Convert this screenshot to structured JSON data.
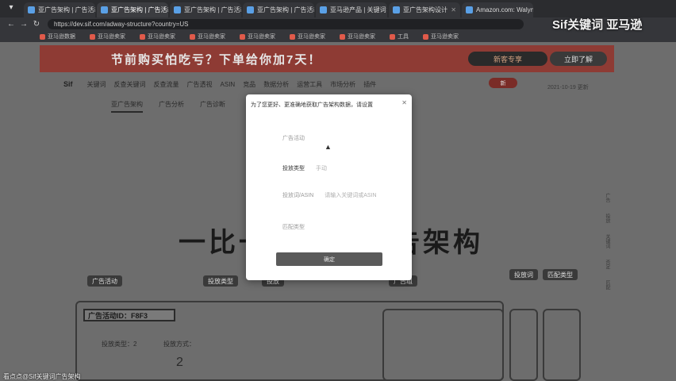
{
  "browser": {
    "tabs": [
      {
        "label": "亚广告架构 | 广告活动"
      },
      {
        "label": "亚广告架构 | 广告活动"
      },
      {
        "label": "亚广告架构 | 广告活动"
      },
      {
        "label": "亚广告架构 | 广告活动"
      },
      {
        "label": "亚马逊产品 | 关键词"
      },
      {
        "label": "亚广告架构设计"
      },
      {
        "label": "Amazon.com: Walyn"
      }
    ],
    "url": "https://dev.sif.com/adway-structure?country=US",
    "bookmarks": [
      "亚马逊数据",
      "亚马逊卖家",
      "亚马逊卖家",
      "亚马逊卖家",
      "亚马逊卖家",
      "亚马逊卖家",
      "亚马逊卖家",
      "工具",
      "亚马逊卖家"
    ]
  },
  "page": {
    "banner_text": "节前购买怕吃亏？下单给你加7天！",
    "banner_pill": "新客专享",
    "banner_button": "立即了解",
    "nav": {
      "logo": "Sif",
      "items": [
        "关键词",
        "反查关键词",
        "反查流量",
        "广告透视",
        "ASIN",
        "竞品",
        "数据分析",
        "运营工具",
        "市场分析",
        "插件"
      ],
      "hot": "新",
      "date": "2021-10-19 更新"
    },
    "subtabs": [
      "亚广告架构",
      "广告分析",
      "广告诊断"
    ],
    "headline_left": "一比一",
    "headline_right": "告架构",
    "diagram": {
      "labels": [
        "广告活动",
        "投放类型",
        "投放",
        "广告组",
        "投放词",
        "匹配类型"
      ],
      "campaign_id": "广告活动ID：F8F3",
      "text_a": "投放类型：2",
      "text_b": "投放方式：",
      "number": "2"
    },
    "side_links": [
      "广告",
      "投放",
      "关键词",
      "否定",
      "匹配"
    ]
  },
  "modal": {
    "title": "为了您更好、更准确地获取广告架构数据，请设置",
    "rows": [
      {
        "label": "广告活动",
        "value": ""
      },
      {
        "label": "投放类型",
        "value": "手动"
      },
      {
        "label": "投放词/ASIN",
        "value": "请输入关键词或ASIN"
      },
      {
        "label": "匹配类型",
        "value": ""
      }
    ],
    "button": "确定"
  },
  "overlay": {
    "watermark": "Sif关键词 亚马逊",
    "footer": "看点点@Sif关键词广告架构"
  }
}
